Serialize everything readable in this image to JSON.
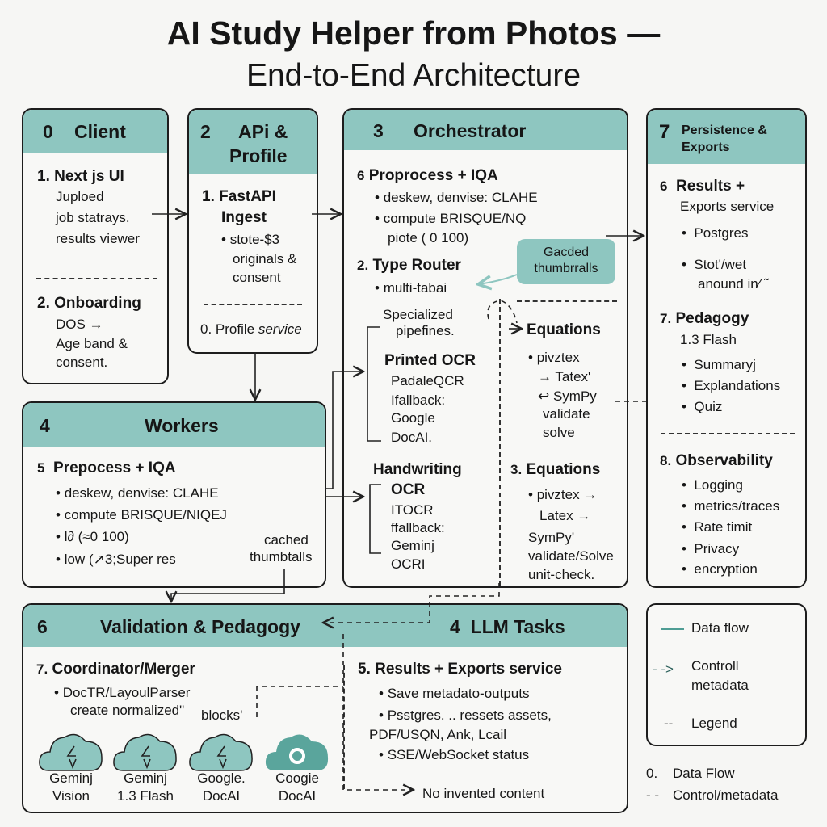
{
  "title": {
    "line1": "AI Study Helper from Photos —",
    "line2": "End-to-End Architecture"
  },
  "client": {
    "num": "0",
    "title": "Client",
    "s1_num": "1.",
    "s1_title": "Next js UI",
    "s1_lines": [
      "Juploed",
      "job statrays.",
      "results viewer"
    ],
    "s2_num": "2.",
    "s2_title": "Onboarding",
    "s2_lines": [
      "DOS →",
      "Age band &",
      "consent."
    ]
  },
  "api": {
    "num": "2",
    "title_l1": "APi &",
    "title_l2": "Profile",
    "s1_num": "1.",
    "s1_title_l1": "FastAPI",
    "s1_title_l2": "Ingest",
    "s1_bullet": [
      "stote-$3",
      "originals &",
      "consent"
    ],
    "s2_num": "0.",
    "s2_title": "Profile",
    "s2_title_italic": "service"
  },
  "orchestrator": {
    "num": "3",
    "title": "Orchestrator",
    "pre_num": "6",
    "pre_title": "Proprocess + IQA",
    "pre_bullets": [
      "deskew, denvise: CLAHE",
      "compute BRISQUE/NQ"
    ],
    "pre_cont": "piote ( 0 100)",
    "router_num": "2.",
    "router_title": "Type Router",
    "router_bullet": "multi-tabai",
    "badge": [
      "Gacded",
      "thumbrralls"
    ],
    "specialized": [
      "Specialized",
      "pipefines."
    ],
    "printed_title": "Printed OCR",
    "printed_lines": [
      "PadaleQCR",
      "Ifallback:",
      "Google",
      "DocAI."
    ],
    "hand_title": [
      "Handwriting",
      "OCR"
    ],
    "hand_lines": [
      "ITOCR",
      "ffallback:",
      "Geminj",
      "OCRI"
    ],
    "eq1_title": "Equations",
    "eq1_lines": [
      "pivztex",
      "→ Tatex'",
      "↩ SymPy",
      "validate",
      "solve"
    ],
    "eq2_num": "3.",
    "eq2_title": "Equations",
    "eq2_lines": [
      "pivztex →",
      "Latex →",
      "SymPy'",
      "validate/Solve",
      "unit-check."
    ]
  },
  "persistence": {
    "num": "7",
    "title_l1": "Persistence &",
    "title_l2": "Exports",
    "s1_num": "6",
    "s1_title": "Results +",
    "s1_sub": "Exports service",
    "s1_bullets": [
      "Postgres",
      "Stot'/wet"
    ],
    "s1_cont": "anound in⁄ ˜",
    "s2_num": "7.",
    "s2_title": "Pedagogy",
    "s2_sub": "1.3 Flash",
    "s2_bullets": [
      "Summaryj",
      "Explandations",
      "Quiz"
    ],
    "s3_num": "8.",
    "s3_title": "Observability",
    "s3_bullets": [
      "Logging",
      "metrics/traces",
      "Rate timit",
      "Privacy",
      "encryption"
    ]
  },
  "workers": {
    "num": "4",
    "title": "Workers",
    "s_num": "5",
    "s_title": "Prepocess + IQA",
    "bullets": [
      "deskew, denvise: CLAHE",
      "compute BRISQUE/NIQEJ",
      "l∂ (≈0 100)",
      "low (↗3;Super res"
    ],
    "cached": [
      "cached",
      "thumbtalls"
    ]
  },
  "validation": {
    "num": "6",
    "title": "Validation & Pedagogy",
    "llm_title": "4  LLM Tasks",
    "coord_num": "7.",
    "coord_title": "Coordinator/Merger",
    "coord_bullet": "DocTR/LayoulParser",
    "coord_cont": "create normalized\"",
    "coord_blocks": "blocks'",
    "results_num": "5.",
    "results_title": "Results + Exports service",
    "results_bullets": [
      "Save metadato-outputs",
      "Psstgres.  .. ressets assets,",
      "SSE/WebSocket status"
    ],
    "results_cont": "PDF/USQN, Ank, Lcail",
    "no_invented": "No invented content",
    "services": [
      {
        "l1": "Geminj",
        "l2": "Vision"
      },
      {
        "l1": "Geminj",
        "l2": "1.3 Flash"
      },
      {
        "l1": "Google.",
        "l2": "DocAI"
      },
      {
        "l1": "Coogie",
        "l2": "DocAI"
      }
    ]
  },
  "legend": {
    "items": [
      "Data flow",
      "Controll",
      "metadata",
      "Legend"
    ],
    "foot": [
      {
        "sym": "0.",
        "label": "Data Flow"
      },
      {
        "sym": "- -",
        "label": "Control/metadata"
      }
    ]
  },
  "colors": {
    "header": "#8ec6c0",
    "accent": "#4f9d94",
    "border": "#1d1d1d"
  }
}
